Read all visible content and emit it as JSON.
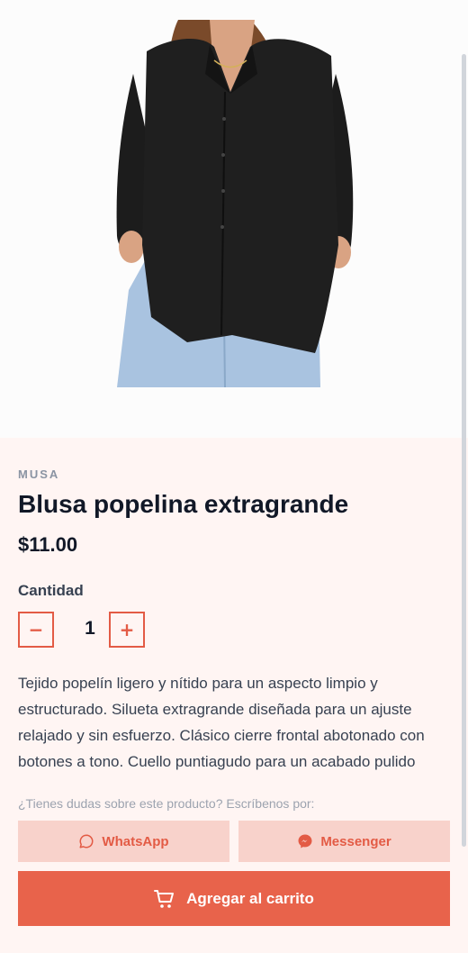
{
  "product": {
    "brand": "MUSA",
    "title": "Blusa popelina extragrande",
    "price": "$11.00",
    "image_icon": "product-photo-black-shirt"
  },
  "quantity": {
    "label": "Cantidad",
    "value": "1",
    "minus": "−",
    "plus": "+"
  },
  "description": "Tejido popelín ligero y nítido para un aspecto limpio y estructurado. Silueta extragrande diseñada para un ajuste relajado y sin esfuerzo. Clásico cierre frontal abotonado con botones a tono. Cuello puntiagudo para un acabado pulido",
  "contact": {
    "hint": "¿Tienes dudas sobre este producto? Escríbenos por:",
    "whatsapp_label": "WhatsApp",
    "messenger_label": "Messenger",
    "whatsapp_icon": "whatsapp-icon",
    "messenger_icon": "messenger-icon"
  },
  "cart": {
    "label": "Agregar al carrito",
    "icon": "cart-icon"
  },
  "colors": {
    "accent": "#e8634b",
    "accent_light": "#f8d2cb",
    "background": "#fff5f3"
  }
}
